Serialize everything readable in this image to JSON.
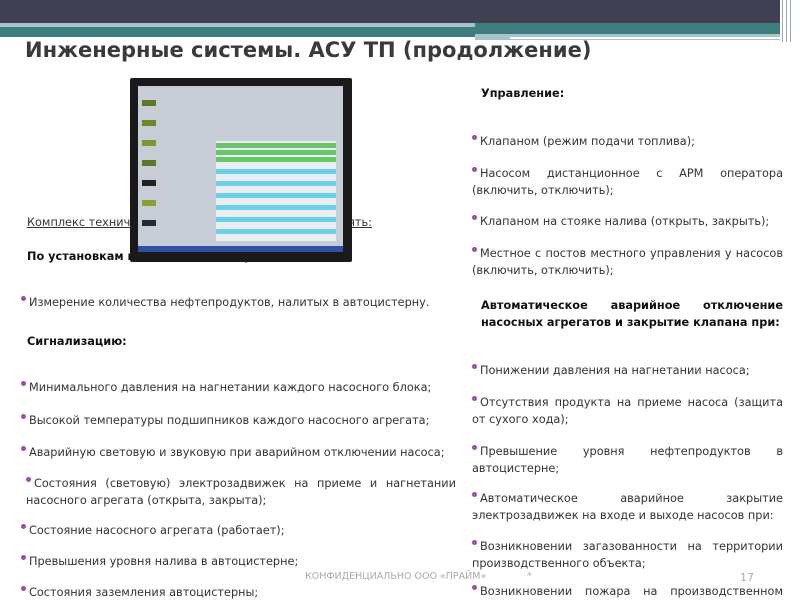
{
  "slide": {
    "title": "Инженерные системы. АСУ ТП (продолжение)"
  },
  "left": {
    "intro": "Комплекс технических средств позволяет осуществлять:",
    "section1": "По установкам налива автоцистерн:",
    "measure": "Измерение количества нефтепродуктов, налитых в автоцистерну.",
    "section2": "Сигнализацию:",
    "items": [
      "Минимального давления на нагнетании каждого насосного блока;",
      "Высокой температуры подшипников каждого насосного агрегата;",
      "Аварийную световую и звуковую при аварийном отключении насоса;",
      "Состояния (световую) электрозадвижек на приеме и нагнетании насосного агрегата (открыта, закрыта);",
      "Состояние насосного агрегата (работает);",
      "Превышения уровня налива в автоцистерне;",
      "Состояния заземления автоцистерны;"
    ]
  },
  "right": {
    "section1": "Управление:",
    "control": [
      "Клапаном (режим подачи топлива);",
      "Насосом дистанционное с АРМ оператора (включить, отключить);",
      "Клапаном на стояке налива (открыть, закрыть);",
      "Местное с постов местного управления у насосов (включить, отключить);"
    ],
    "section2": "Автоматическое аварийное отключение насосных агрегатов и закрытие клапана при:",
    "auto": [
      "Понижении давления на нагнетании насоса;",
      "Отсутствия продукта на приеме насоса (защита от сухого хода);",
      "Превышение уровня нефтепродуктов в автоцистерне;",
      "Автоматическое аварийное закрытие электрозадвижек на входе и выходе насосов при:",
      "Возникновении загазованности на территории производственного объекта;",
      "Возникновении пожара на производственном"
    ]
  },
  "footer": {
    "confidential": "КОНФИДЕНЦИАЛЬНО ООО «ПРАЙМ»",
    "star": "*",
    "page": "17"
  }
}
